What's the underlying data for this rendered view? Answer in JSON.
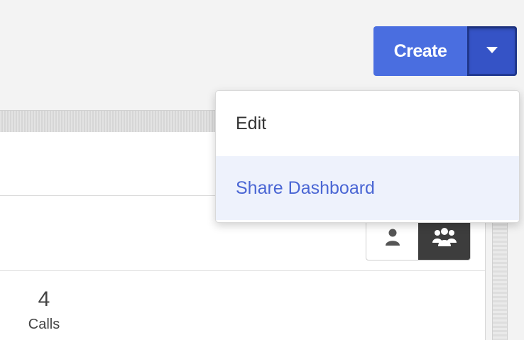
{
  "header": {
    "create_label": "Create"
  },
  "dropdown": {
    "items": [
      {
        "label": "Edit"
      },
      {
        "label": "Share Dashboard"
      }
    ]
  },
  "view_toggle": {
    "options": [
      {
        "icon": "person-icon",
        "active": false
      },
      {
        "icon": "group-icon",
        "active": true
      }
    ]
  },
  "metric": {
    "value": "4",
    "label": "Calls"
  },
  "colors": {
    "primary": "#4a6ee0",
    "primary_dark": "#3553c6",
    "menu_highlight": "#eef2fc",
    "link_text": "#4a66d4",
    "toggle_active": "#3d3d3d"
  }
}
